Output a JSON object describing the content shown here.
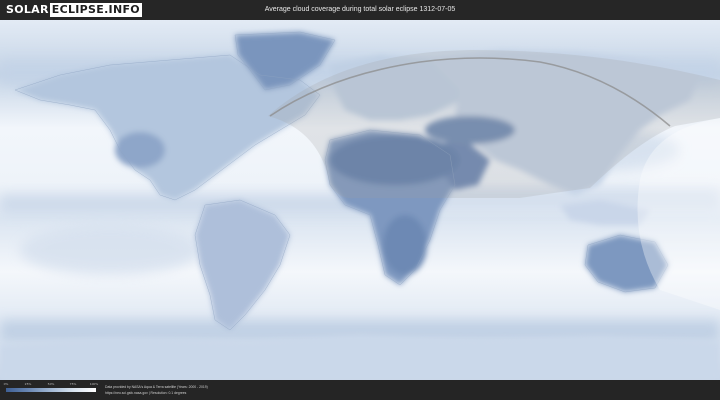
{
  "header": {
    "logo_part1": "SOLAR",
    "logo_part2": "ECLIPSE.INFO",
    "title": "Average cloud coverage during total solar eclipse 1312-07-05"
  },
  "footer": {
    "legend_ticks": [
      "0%",
      "25%",
      "50%",
      "75%",
      "100%"
    ],
    "credit_line1": "Data provided by NASA's Aqua & Terra satellite (Years: 2000 - 2019)",
    "credit_line2": "https://neo.sci.gsfc.nasa.gov | Resolution: 0.1 degrees"
  },
  "colors": {
    "ocean_cloud": "#eef3f9",
    "land_cloud": "#d5e0ee",
    "clear_sky": "#4d6c9c",
    "eclipse_shade": "#9a9a9a",
    "header_bg": "#262626"
  }
}
